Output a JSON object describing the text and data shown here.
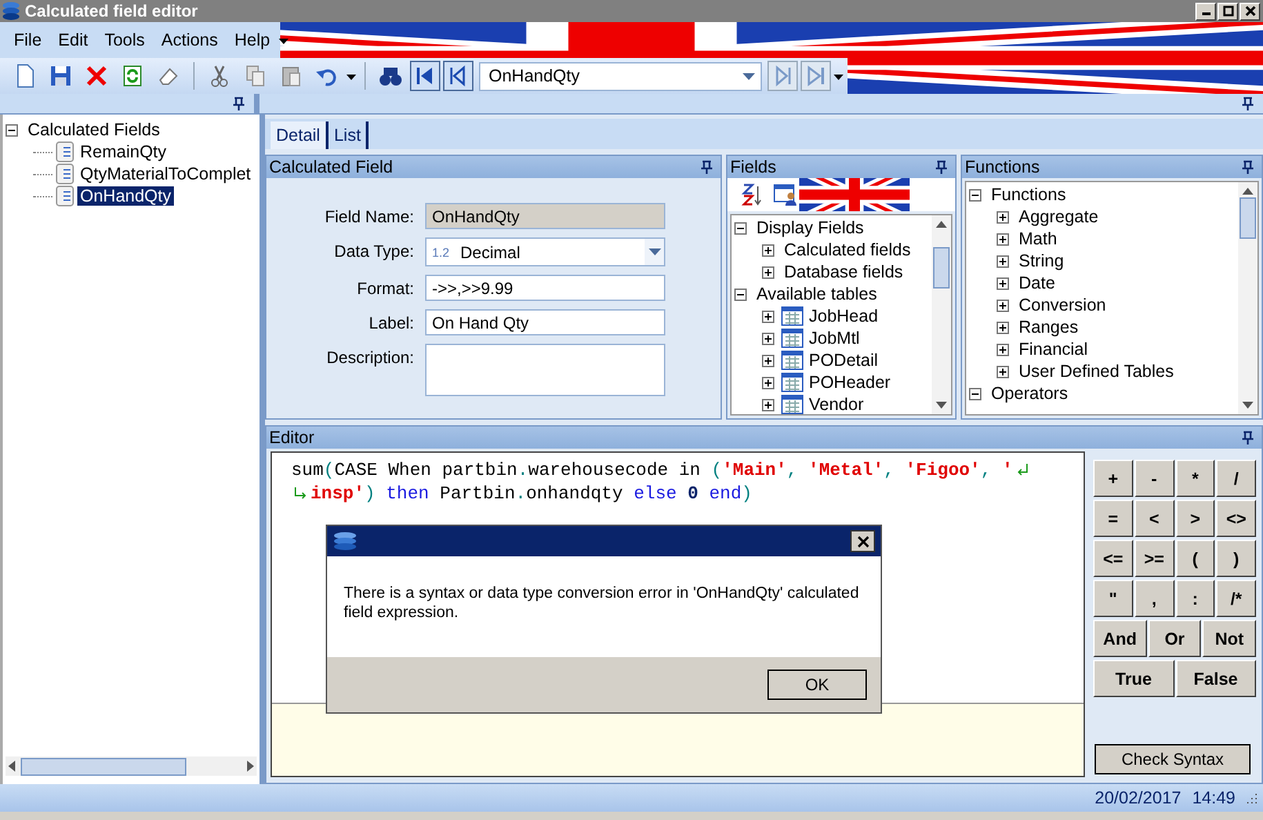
{
  "window": {
    "title": "Calculated field editor"
  },
  "menu": [
    "File",
    "Edit",
    "Tools",
    "Actions",
    "Help"
  ],
  "toolbar": {
    "record": "OnHandQty"
  },
  "tree": [
    {
      "label": "Calculated Fields",
      "expanded": true,
      "selected": false,
      "children": [
        {
          "label": "RemainQty",
          "kind": "field",
          "selected": false
        },
        {
          "label": "QtyMaterialToComplet",
          "kind": "field",
          "selected": false
        },
        {
          "label": "OnHandQty",
          "kind": "field",
          "selected": true
        }
      ]
    }
  ],
  "tabs": [
    {
      "label": "Detail",
      "selected": true
    },
    {
      "label": "List",
      "selected": false
    }
  ],
  "calculated_field": {
    "title": "Calculated Field",
    "fields": [
      {
        "label": "Field Name:",
        "kind": "readonly",
        "value": "OnHandQty"
      },
      {
        "label": "Data Type:",
        "kind": "dropdown",
        "prefix": "1.2",
        "value": "Decimal"
      },
      {
        "label": "Format:",
        "kind": "text",
        "value": "->>,>>9.99"
      },
      {
        "label": "Label:",
        "kind": "text",
        "value": "On Hand Qty"
      },
      {
        "label": "Description:",
        "kind": "textarea"
      }
    ]
  },
  "fields_panel": {
    "title": "Fields",
    "tree": [
      {
        "label": "Display Fields",
        "expanded": true,
        "children": [
          {
            "label": "Calculated fields",
            "expanded": false
          },
          {
            "label": "Database fields",
            "expanded": false
          }
        ]
      },
      {
        "label": "Available tables",
        "expanded": true,
        "children": [
          {
            "label": "JobHead",
            "kind": "table",
            "expanded": false
          },
          {
            "label": "JobMtl",
            "kind": "table",
            "expanded": false
          },
          {
            "label": "PODetail",
            "kind": "table",
            "expanded": false
          },
          {
            "label": "POHeader",
            "kind": "table",
            "expanded": false
          },
          {
            "label": "Vendor",
            "kind": "table",
            "expanded": false
          }
        ]
      }
    ]
  },
  "functions_panel": {
    "title": "Functions",
    "tree": [
      {
        "label": "Functions",
        "expanded": true,
        "children": [
          {
            "label": "Aggregate",
            "expanded": false
          },
          {
            "label": "Math",
            "expanded": false
          },
          {
            "label": "String",
            "expanded": false
          },
          {
            "label": "Date",
            "expanded": false
          },
          {
            "label": "Conversion",
            "expanded": false
          },
          {
            "label": "Ranges",
            "expanded": false
          },
          {
            "label": "Financial",
            "expanded": false
          },
          {
            "label": "User Defined Tables",
            "expanded": false
          }
        ]
      },
      {
        "label": "Operators",
        "expanded": true
      }
    ]
  },
  "editor": {
    "title": "Editor",
    "lines": [
      [
        {
          "kind": "plain",
          "text": "sum"
        },
        {
          "kind": "punct",
          "text": "("
        },
        {
          "kind": "plain",
          "text": "CASE When partbin"
        },
        {
          "kind": "punct",
          "text": "."
        },
        {
          "kind": "plain",
          "text": "warehousecode in "
        },
        {
          "kind": "punct",
          "text": "("
        },
        {
          "kind": "string",
          "text": "'Main'"
        },
        {
          "kind": "punct",
          "text": ", "
        },
        {
          "kind": "string",
          "text": "'Metal'"
        },
        {
          "kind": "punct",
          "text": ", "
        },
        {
          "kind": "string",
          "text": "'Figoo'"
        },
        {
          "kind": "punct",
          "text": ", "
        },
        {
          "kind": "string",
          "text": "'"
        },
        {
          "kind": "wrap_out"
        }
      ],
      [
        {
          "kind": "wrap_in"
        },
        {
          "kind": "string",
          "text": "insp'"
        },
        {
          "kind": "punct",
          "text": ") "
        },
        {
          "kind": "keyword",
          "text": "then"
        },
        {
          "kind": "plain",
          "text": " Partbin"
        },
        {
          "kind": "punct",
          "text": "."
        },
        {
          "kind": "plain",
          "text": "onhandqty "
        },
        {
          "kind": "keyword",
          "text": "else "
        },
        {
          "kind": "number",
          "text": "0"
        },
        {
          "kind": "keyword",
          "text": " end"
        },
        {
          "kind": "punct",
          "text": ")"
        }
      ]
    ],
    "keypad": [
      [
        "+",
        "-",
        "*",
        "/"
      ],
      [
        "=",
        "<",
        ">",
        "<>"
      ],
      [
        "<=",
        ">=",
        "(",
        ")"
      ],
      [
        "\"",
        ",",
        ":",
        "/*"
      ],
      [
        "And",
        "Or",
        "Not"
      ],
      [
        "True",
        "False"
      ]
    ],
    "check_button": "Check Syntax"
  },
  "dialog": {
    "message": "There is a syntax or data type conversion error in 'OnHandQty' calculated field expression.",
    "button": "OK"
  },
  "status_bar": {
    "date": "20/02/2017",
    "time": "14:49"
  }
}
